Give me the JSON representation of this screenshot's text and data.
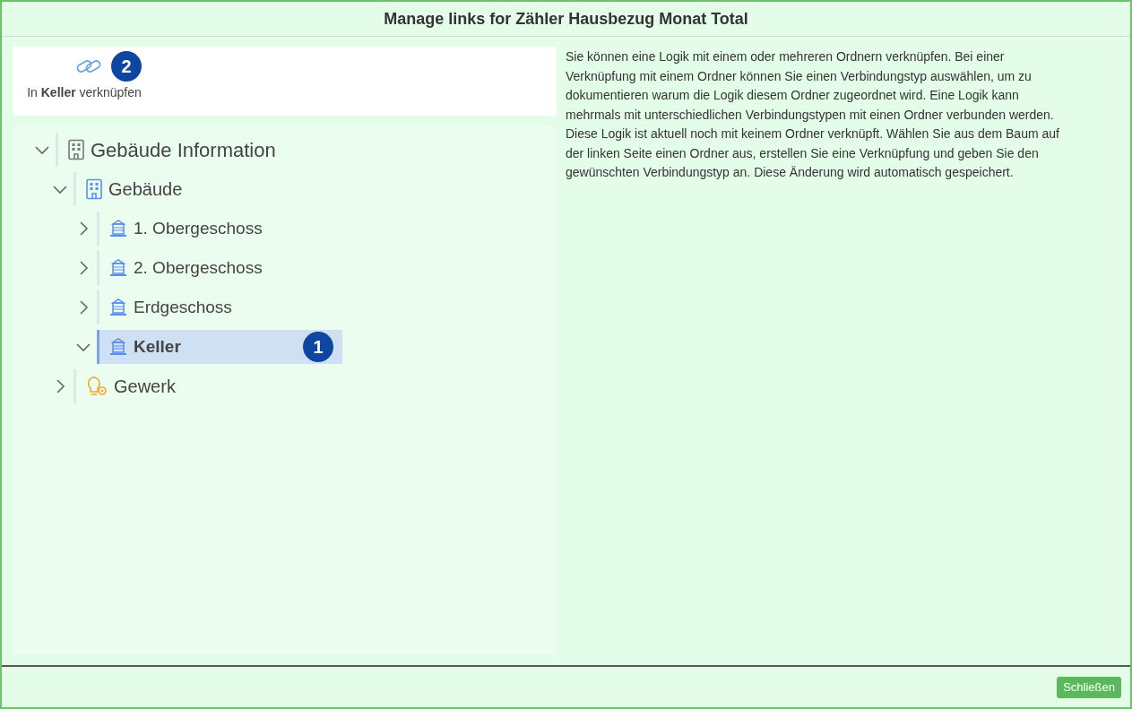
{
  "window": {
    "title": "Manage links for Zähler Hausbezug Monat Total"
  },
  "link_action": {
    "badge": "2",
    "label": "In **Keller** verknüpfen"
  },
  "tree": [
    {
      "label": "Gebäude Information",
      "kind": "info",
      "expanded": true,
      "selected": false,
      "children": [
        {
          "label": "Gebäude",
          "kind": "building",
          "expanded": true,
          "selected": false,
          "children": [
            {
              "label": "1. Obergeschoss",
              "kind": "floor",
              "expanded": false,
              "selected": false
            },
            {
              "label": "2. Obergeschoss",
              "kind": "floor",
              "expanded": false,
              "selected": false
            },
            {
              "label": "Erdgeschoss",
              "kind": "floor",
              "expanded": false,
              "selected": false
            },
            {
              "label": "Keller",
              "kind": "floor",
              "expanded": true,
              "selected": true,
              "badge": "1"
            }
          ]
        },
        {
          "label": "Gewerk",
          "kind": "trade",
          "expanded": false,
          "selected": false
        }
      ]
    }
  ],
  "description": "Sie können eine Logik mit einem oder mehreren Ordnern verknüpfen. Bei einer Verknüpfung mit einem Ordner können Sie einen Verbindungstyp auswählen, um zu dokumentieren warum die Logik diesem Ordner zugeordnet wird. Eine Logik kann mehrmals mit unterschiedlichen Verbindungstypen mit einen Ordner verbunden werden. Diese Logik ist aktuell noch mit keinem Ordner verknüpft. Wählen Sie aus dem Baum auf der linken Seite einen Ordner aus, erstellen Sie eine Verknüpfung und geben Sie den gewünschten Verbindungstyp an. Diese Änderung wird automatisch gespeichert.",
  "buttons": [
    {
      "label": "Schließen"
    }
  ]
}
